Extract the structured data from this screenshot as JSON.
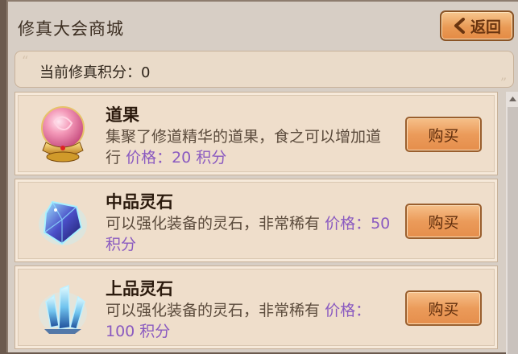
{
  "header": {
    "title": "修真大会商城",
    "back_label": "返回"
  },
  "points": {
    "label": "当前修真积分：",
    "value": "0",
    "open_quote": "“",
    "close_quote": "”"
  },
  "items": [
    {
      "name": "道果",
      "desc": "集聚了修道精华的道果，食之可以增加道行",
      "price": "价格：20 积分",
      "buy_label": "购买",
      "icon": "crystal-orb-icon"
    },
    {
      "name": "中品灵石",
      "desc": "可以强化装备的灵石，非常稀有",
      "price": "价格：50 积分",
      "buy_label": "购买",
      "icon": "blue-spirit-stone-icon"
    },
    {
      "name": "上品灵石",
      "desc": "可以强化装备的灵石，非常稀有",
      "price": "价格：100 积分",
      "buy_label": "购买",
      "icon": "cyan-crystal-cluster-icon"
    }
  ],
  "colors": {
    "accent_button": "#e99a55",
    "price_text": "#8a5ac0",
    "panel_bg": "#d7cec5"
  }
}
